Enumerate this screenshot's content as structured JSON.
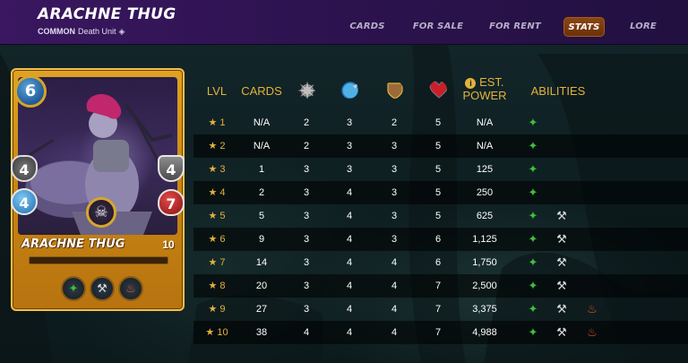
{
  "header": {
    "title": "ARACHNE THUG",
    "rarity": "COMMON",
    "unit_type": "Death Unit",
    "tabs": [
      {
        "label": "CARDS",
        "active": false
      },
      {
        "label": "FOR SALE",
        "active": false
      },
      {
        "label": "FOR RENT",
        "active": false
      },
      {
        "label": "STATS",
        "active": true
      },
      {
        "label": "LORE",
        "active": false
      }
    ]
  },
  "card": {
    "mana": "6",
    "melee": "4",
    "armor": "4",
    "speed": "4",
    "health": "7",
    "name": "ARACHNE THUG",
    "level": "10",
    "abilities": [
      "claw-icon",
      "hammer-icon",
      "fire-icon"
    ]
  },
  "table": {
    "headers": {
      "lvl": "LVL",
      "cards": "CARDS",
      "melee_icon": "melee-attack-icon",
      "speed_icon": "speed-icon",
      "armor_icon": "armor-shield-icon",
      "health_icon": "health-heart-icon",
      "power_line1": "EST.",
      "power_line2": "POWER",
      "abilities": "ABILITIES"
    },
    "rows": [
      {
        "lvl": "★ 1",
        "cards": "N/A",
        "melee": "2",
        "speed": "3",
        "armor": "2",
        "health": "5",
        "power": "N/A",
        "abilities": [
          "claw"
        ]
      },
      {
        "lvl": "★ 2",
        "cards": "N/A",
        "melee": "2",
        "speed": "3",
        "armor": "3",
        "health": "5",
        "power": "N/A",
        "abilities": [
          "claw"
        ]
      },
      {
        "lvl": "★ 3",
        "cards": "1",
        "melee": "3",
        "speed": "3",
        "armor": "3",
        "health": "5",
        "power": "125",
        "abilities": [
          "claw"
        ]
      },
      {
        "lvl": "★ 4",
        "cards": "2",
        "melee": "3",
        "speed": "4",
        "armor": "3",
        "health": "5",
        "power": "250",
        "abilities": [
          "claw"
        ]
      },
      {
        "lvl": "★ 5",
        "cards": "5",
        "melee": "3",
        "speed": "4",
        "armor": "3",
        "health": "5",
        "power": "625",
        "abilities": [
          "claw",
          "hammer"
        ]
      },
      {
        "lvl": "★ 6",
        "cards": "9",
        "melee": "3",
        "speed": "4",
        "armor": "3",
        "health": "6",
        "power": "1,125",
        "abilities": [
          "claw",
          "hammer"
        ]
      },
      {
        "lvl": "★ 7",
        "cards": "14",
        "melee": "3",
        "speed": "4",
        "armor": "4",
        "health": "6",
        "power": "1,750",
        "abilities": [
          "claw",
          "hammer"
        ]
      },
      {
        "lvl": "★ 8",
        "cards": "20",
        "melee": "3",
        "speed": "4",
        "armor": "4",
        "health": "7",
        "power": "2,500",
        "abilities": [
          "claw",
          "hammer"
        ]
      },
      {
        "lvl": "★ 9",
        "cards": "27",
        "melee": "3",
        "speed": "4",
        "armor": "4",
        "health": "7",
        "power": "3,375",
        "abilities": [
          "claw",
          "hammer",
          "fire"
        ]
      },
      {
        "lvl": "★ 10",
        "cards": "38",
        "melee": "4",
        "speed": "4",
        "armor": "4",
        "health": "7",
        "power": "4,988",
        "abilities": [
          "claw",
          "hammer",
          "fire"
        ]
      }
    ]
  },
  "colors": {
    "header_bg": "#2d1350",
    "gold": "#e3b23c",
    "active_tab": "#7a3a0c",
    "claw_ability": "#3fbf3a",
    "fire_ability": "#e1532a"
  }
}
